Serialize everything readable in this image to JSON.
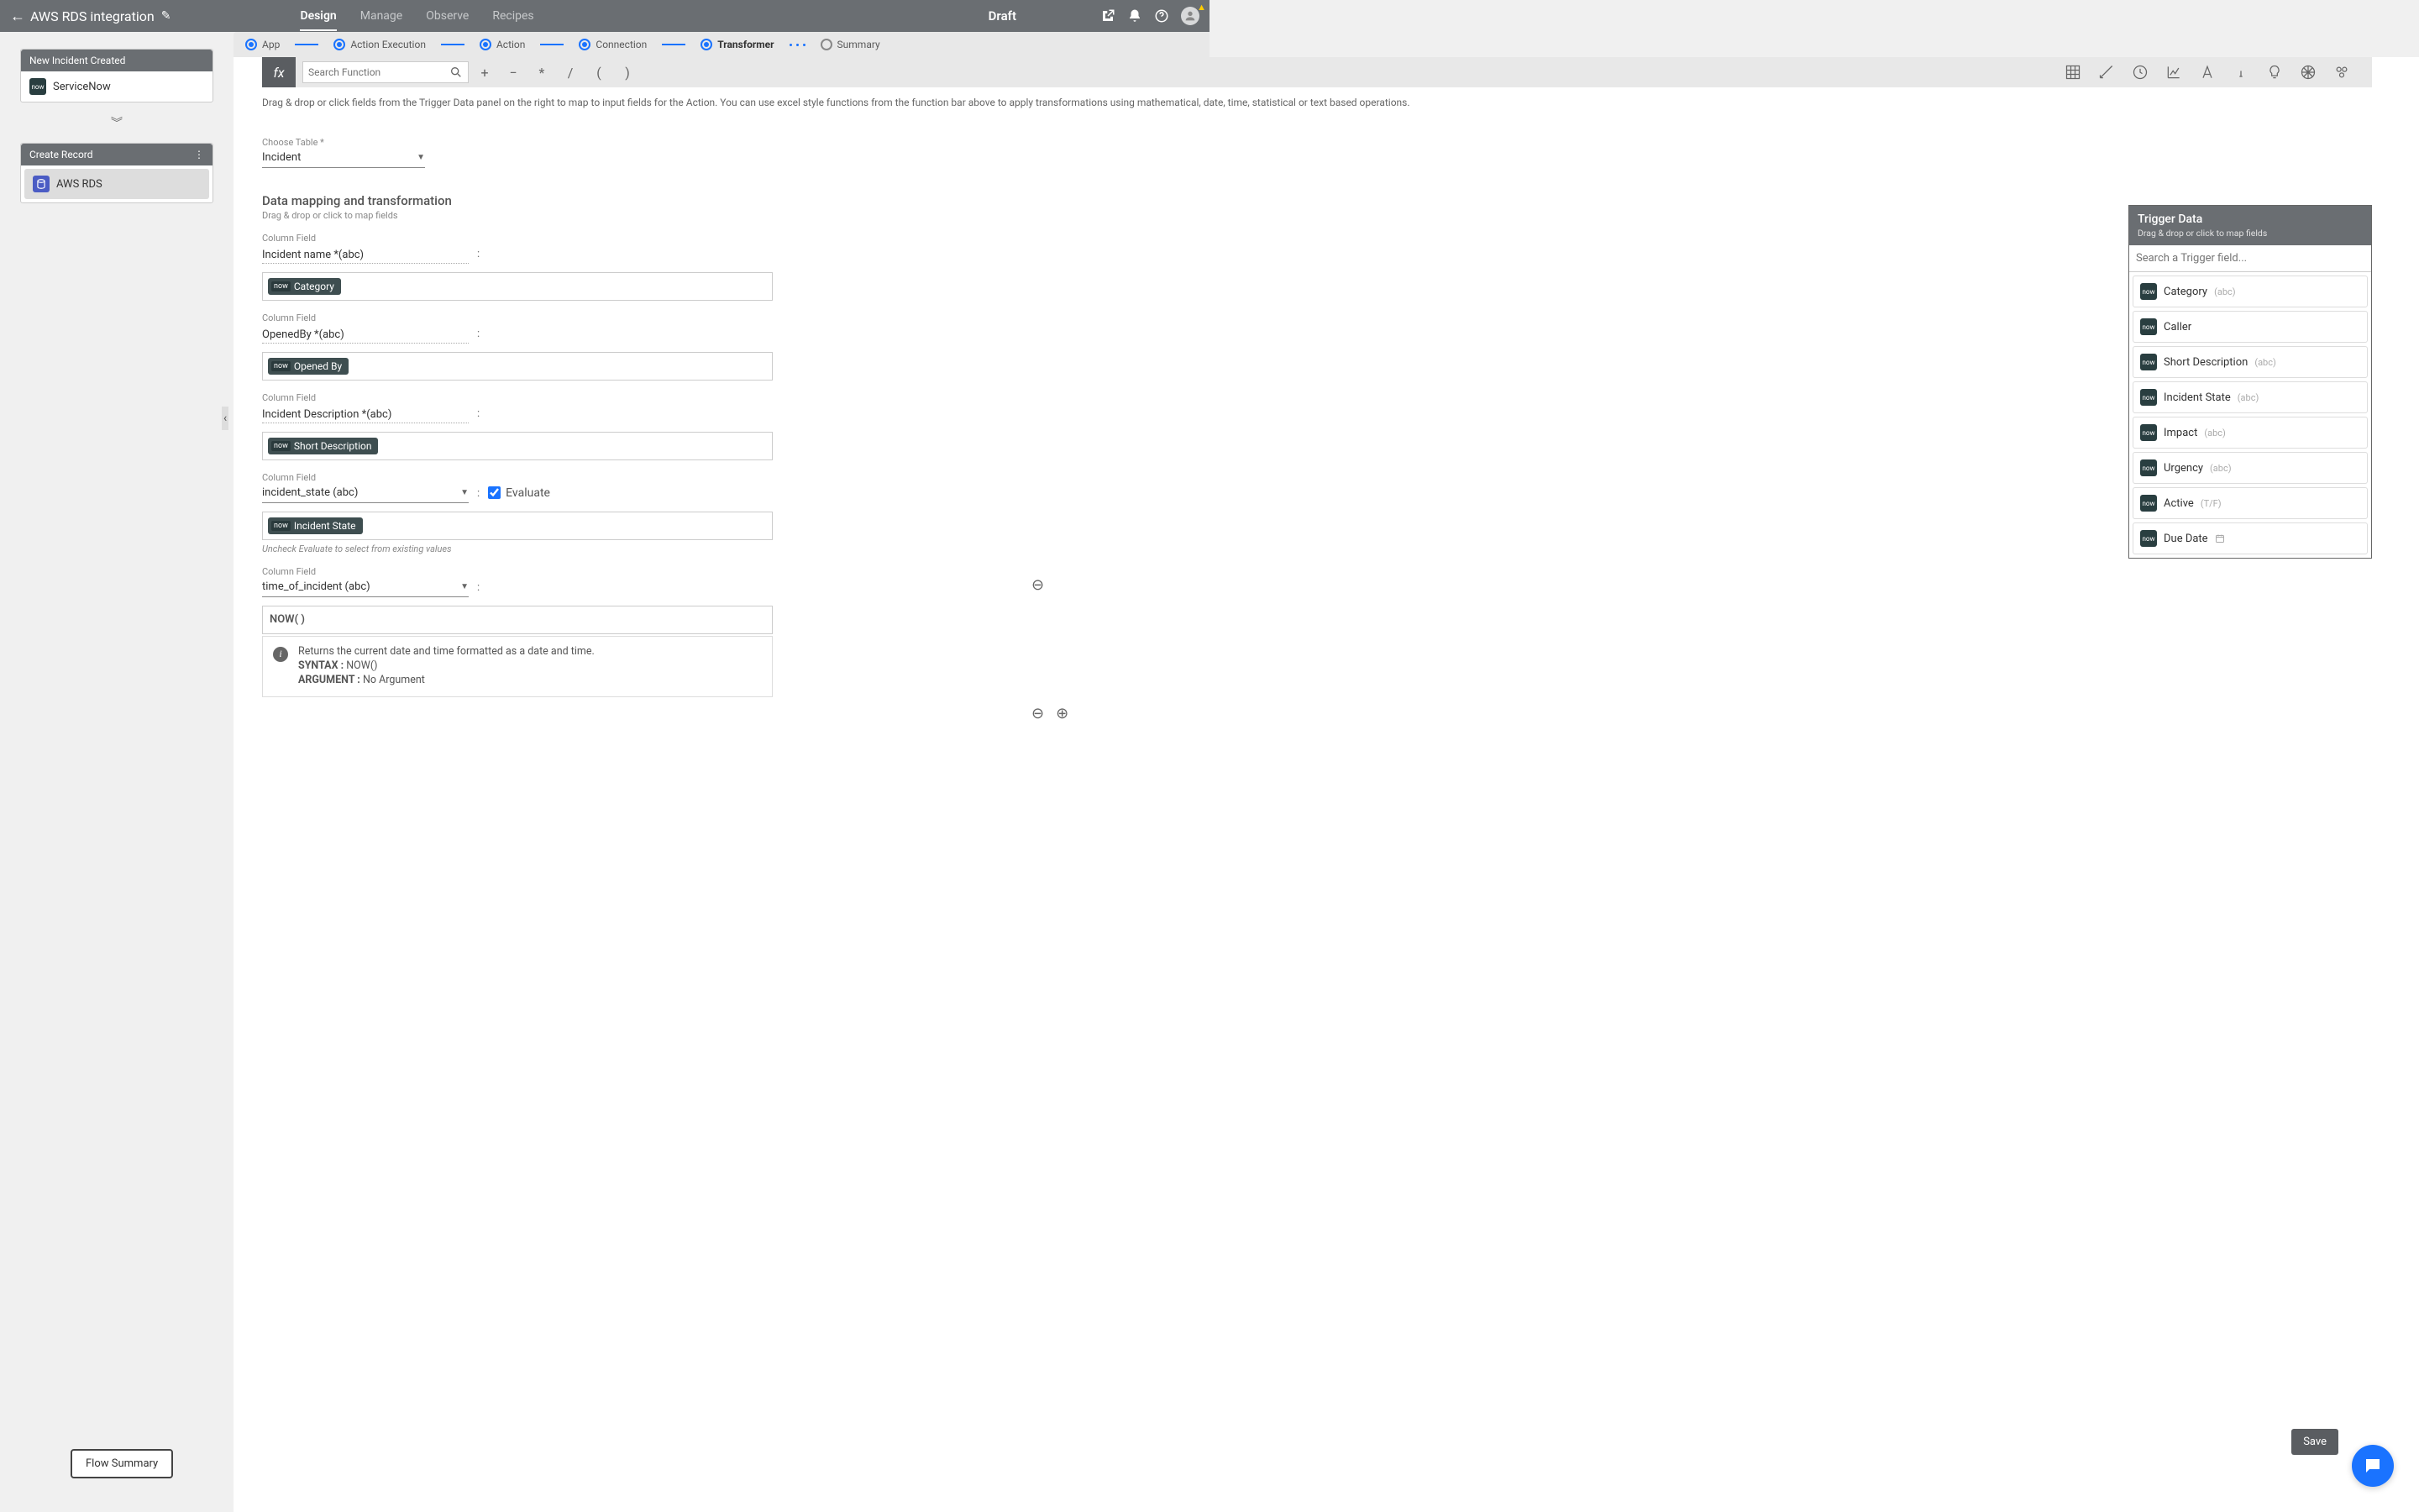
{
  "topbar": {
    "title": "AWS RDS integration",
    "tabs": [
      "Design",
      "Manage",
      "Observe",
      "Recipes"
    ],
    "active_tab": "Design",
    "status": "Draft"
  },
  "steps": {
    "items": [
      "App",
      "Action Execution",
      "Action",
      "Connection",
      "Transformer",
      "Summary"
    ],
    "completed_through": 4,
    "current": "Transformer"
  },
  "left": {
    "card1_header": "New Incident Created",
    "card1_item": "ServiceNow",
    "card2_header": "Create Record",
    "card2_item": "AWS RDS",
    "flow_summary_btn": "Flow Summary"
  },
  "func_bar": {
    "fx": "fx",
    "search_placeholder": "Search Function",
    "ops": [
      "+",
      "−",
      "*",
      "/",
      "(",
      ")"
    ]
  },
  "help_text": "Drag & drop or click fields from the Trigger Data panel on the right to map to input fields for the Action. You can use excel style functions from the function bar above to apply transformations using mathematical, date, time, statistical or text based operations.",
  "table": {
    "label": "Choose Table *",
    "value": "Incident"
  },
  "section": {
    "title": "Data mapping and transformation",
    "subtitle": "Drag & drop or click to map fields"
  },
  "fields": [
    {
      "label": "Column Field",
      "name": "Incident name *(abc)",
      "chip": "Category"
    },
    {
      "label": "Column Field",
      "name": "OpenedBy *(abc)",
      "chip": "Opened By"
    },
    {
      "label": "Column Field",
      "name": "Incident Description *(abc)",
      "chip": "Short Description"
    }
  ],
  "field4": {
    "label": "Column Field",
    "name": "incident_state (abc)",
    "chip": "Incident State",
    "evaluate_label": "Evaluate",
    "evaluate_checked": true,
    "note": "Uncheck Evaluate to select from existing values"
  },
  "field5": {
    "label": "Column Field",
    "name": "time_of_incident (abc)",
    "formula": "NOW( )"
  },
  "hint": {
    "line1": "Returns the current date and time formatted as a date and time.",
    "syntax_label": "SYNTAX :",
    "syntax_val": "NOW()",
    "arg_label": "ARGUMENT :",
    "arg_val": "No Argument"
  },
  "trigger_panel": {
    "title": "Trigger Data",
    "subtitle": "Drag & drop or click to map fields",
    "search_placeholder": "Search a Trigger field...",
    "items": [
      {
        "name": "Category",
        "type": "(abc)"
      },
      {
        "name": "Caller",
        "type": ""
      },
      {
        "name": "Short Description",
        "type": "(abc)"
      },
      {
        "name": "Incident State",
        "type": "(abc)"
      },
      {
        "name": "Impact",
        "type": "(abc)"
      },
      {
        "name": "Urgency",
        "type": "(abc)"
      },
      {
        "name": "Active",
        "type": "(T/F)"
      },
      {
        "name": "Due Date",
        "type": "cal"
      }
    ]
  },
  "save_label": "Save"
}
